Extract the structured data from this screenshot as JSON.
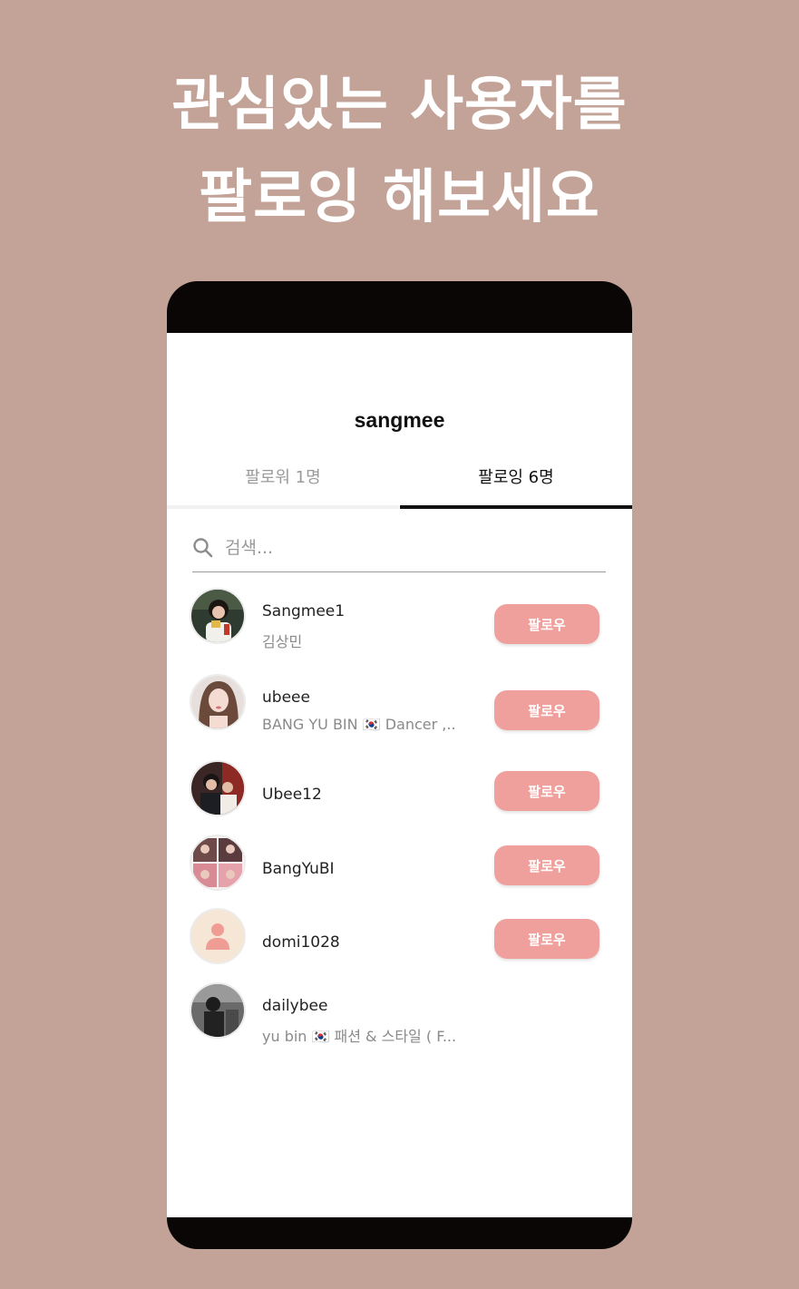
{
  "headline": {
    "line1": "관심있는 사용자를",
    "line2": "팔로잉 해보세요"
  },
  "colors": {
    "background": "#c3a398",
    "follow_button": "#f0a09c",
    "phone_frame": "#0a0606"
  },
  "app": {
    "title": "sangmee",
    "tabs": [
      {
        "label": "팔로워 1명",
        "active": false
      },
      {
        "label": "팔로잉 6명",
        "active": true
      }
    ],
    "search": {
      "placeholder": "검색...",
      "icon": "search-icon"
    },
    "follow_label": "팔로우",
    "users": [
      {
        "username": "Sangmee1",
        "bio": "김상민",
        "has_follow_button": true,
        "avatar": "photo"
      },
      {
        "username": "ubeee",
        "bio": "BANG YU BIN 🇰🇷 Dancer ,...",
        "has_follow_button": true,
        "avatar": "photo"
      },
      {
        "username": "Ubee12",
        "bio": "",
        "has_follow_button": true,
        "avatar": "photo"
      },
      {
        "username": "BangYuBI",
        "bio": "",
        "has_follow_button": true,
        "avatar": "photo-grid"
      },
      {
        "username": "domi1028",
        "bio": "",
        "has_follow_button": true,
        "avatar": "default-person-icon"
      },
      {
        "username": "dailybee",
        "bio": "yu bin 🇰🇷 패션 & 스타일 ( F...",
        "has_follow_button": false,
        "avatar": "photo-bw"
      }
    ]
  }
}
